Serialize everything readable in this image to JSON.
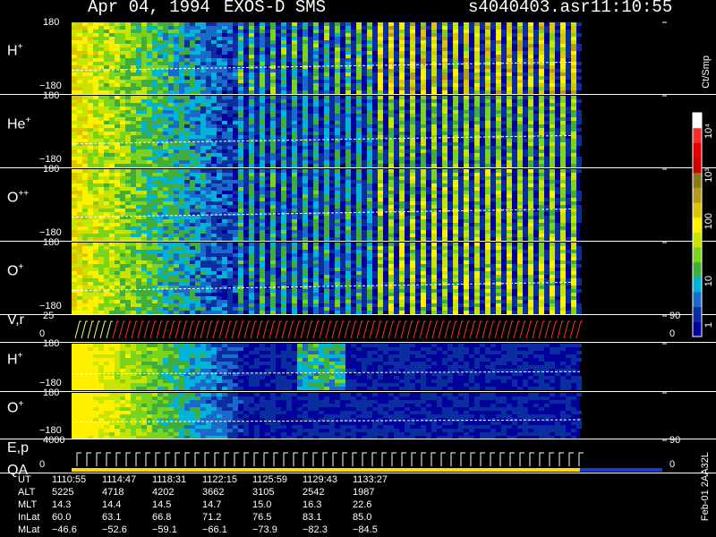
{
  "header": {
    "date": "Apr 04, 1994",
    "instrument": "EXOS-D SMS",
    "file": "s4040403.asr",
    "time": "11:10:55"
  },
  "colorbar": {
    "title": "Ct/Smp",
    "tick_labels": [
      "1",
      "10",
      "100",
      "10³",
      "10⁴"
    ],
    "colors": [
      "#00009a",
      "#0a2ea0",
      "#1a6acc",
      "#00b4d8",
      "#3fae3f",
      "#7ad41e",
      "#c9e400",
      "#fff000",
      "#dcc400",
      "#b59a1e",
      "#8a7a16",
      "#c80000",
      "#e60000",
      "#ff2c2c",
      "#ffffff"
    ]
  },
  "side_label": "Feb-01 2AA32L",
  "panels": [
    {
      "id": "hplus",
      "label_main": "H",
      "label_sup": "+",
      "ytop": "180",
      "ybot": "−180"
    },
    {
      "id": "heplus",
      "label_main": "He",
      "label_sup": "+",
      "ytop": "180",
      "ybot": "−180"
    },
    {
      "id": "oplusplus",
      "label_main": "O",
      "label_sup": "++",
      "ytop": "180",
      "ybot": "−180"
    },
    {
      "id": "oplus",
      "label_main": "O",
      "label_sup": "+",
      "ytop": "180",
      "ybot": "−180"
    },
    {
      "id": "vr",
      "label_main": "V,r",
      "label_sup": "",
      "ytop": "25",
      "ybot": "0",
      "right_top": "90",
      "right_bot": "0"
    },
    {
      "id": "hplus2",
      "label_main": "H",
      "label_sup": "+",
      "ytop": "180",
      "ybot": "−180"
    },
    {
      "id": "oplus2",
      "label_main": "O",
      "label_sup": "+",
      "ytop": "180",
      "ybot": "−180"
    },
    {
      "id": "ep",
      "label_main": "E,p",
      "label_sub": "QA",
      "label_sup": "",
      "ytop": "4000",
      "ybot": "0",
      "right_top": "90",
      "right_bot": "0"
    }
  ],
  "table": {
    "row_labels": [
      "UT",
      "ALT",
      "MLT",
      "InLat",
      "MLat"
    ],
    "columns": [
      [
        "1110:55",
        "5225",
        "14.3",
        "60.0",
        "−46.6"
      ],
      [
        "1114:47",
        "4718",
        "14.4",
        "63.1",
        "−52.6"
      ],
      [
        "1118:31",
        "4202",
        "14.5",
        "66.8",
        "−59.1"
      ],
      [
        "1122:15",
        "3662",
        "14.7",
        "71.2",
        "−66.1"
      ],
      [
        "1125:59",
        "3105",
        "15.0",
        "76.5",
        "−73.9"
      ],
      [
        "1129:43",
        "2542",
        "16.3",
        "83.1",
        "−82.3"
      ],
      [
        "1133:27",
        "1987",
        "22.6",
        "85.0",
        "−84.5"
      ]
    ]
  },
  "chart_data": {
    "type": "heatmap",
    "title": "Apr 04, 1994   EXOS-D SMS   s4040403.asr   11:10:55",
    "xlabel": "UT",
    "x_ticks": [
      "1110:55",
      "1114:47",
      "1118:31",
      "1122:15",
      "1125:59",
      "1129:43",
      "1133:27"
    ],
    "colorbar_label": "Ct/Smp",
    "colorbar_range": [
      1,
      10000
    ],
    "colorbar_scale": "log",
    "panels": [
      {
        "name": "H+",
        "ylim": [
          -180,
          180
        ]
      },
      {
        "name": "He+",
        "ylim": [
          -180,
          180
        ]
      },
      {
        "name": "O++",
        "ylim": [
          -180,
          180
        ]
      },
      {
        "name": "O+",
        "ylim": [
          -180,
          180
        ]
      },
      {
        "name": "V,r",
        "ylim": [
          0,
          25
        ],
        "y2lim": [
          0,
          90
        ]
      },
      {
        "name": "H+",
        "ylim": [
          -180,
          180
        ]
      },
      {
        "name": "O+",
        "ylim": [
          -180,
          180
        ]
      },
      {
        "name": "E,p",
        "ylim": [
          0,
          4000
        ],
        "y2lim": [
          0,
          90
        ]
      }
    ]
  }
}
